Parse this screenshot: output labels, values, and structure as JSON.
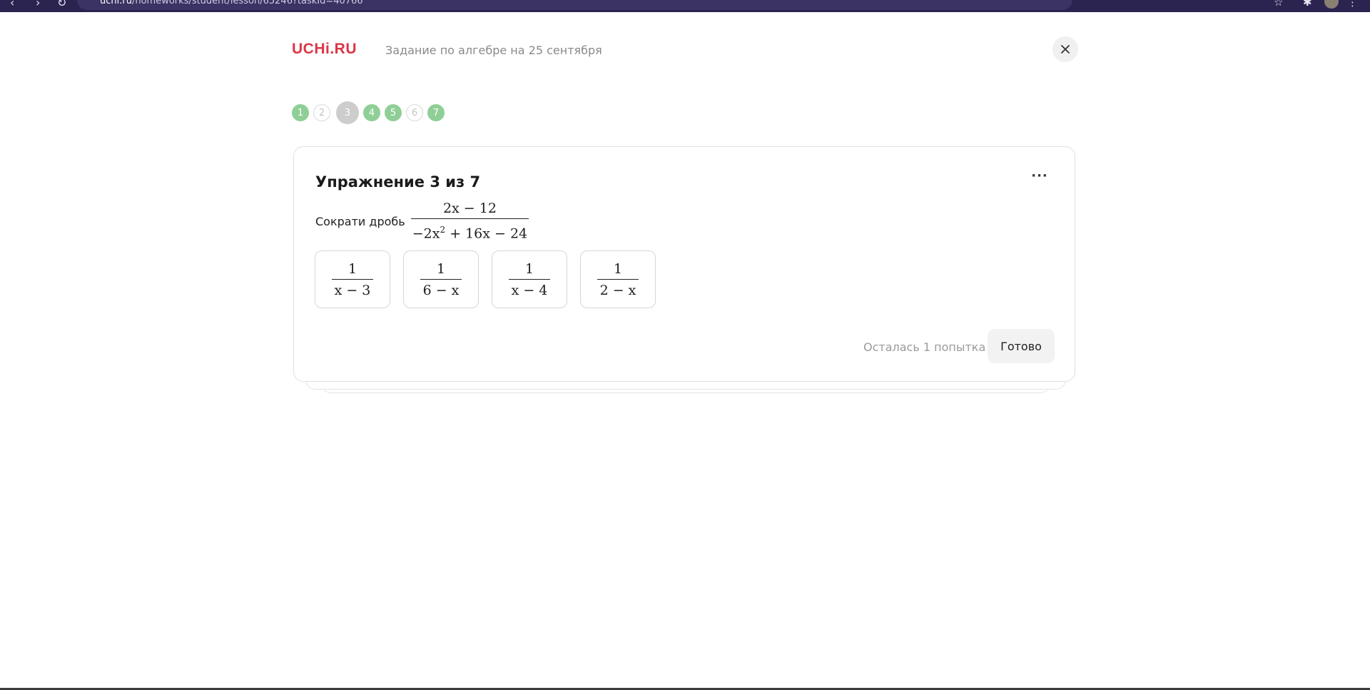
{
  "browser": {
    "url_host": "uchi.ru",
    "url_path": "/homeworks/student/lesson/65246?taskId=40766"
  },
  "header": {
    "logo": "UCHi.RU",
    "subtitle": "Задание по алгебре на 25 сентября",
    "close_icon": "close-icon"
  },
  "steps": [
    {
      "label": "1",
      "state": "done"
    },
    {
      "label": "2",
      "state": "todo"
    },
    {
      "label": "3",
      "state": "current"
    },
    {
      "label": "4",
      "state": "done"
    },
    {
      "label": "5",
      "state": "done"
    },
    {
      "label": "6",
      "state": "todo"
    },
    {
      "label": "7",
      "state": "done"
    }
  ],
  "exercise": {
    "title": "Упражнение 3 из 7",
    "more_label": "···",
    "prompt": "Сократи дробь",
    "fraction": {
      "numerator": "2x − 12",
      "denominator_a": "−2x",
      "denominator_exp": "2",
      "denominator_b": " + 16x − 24"
    },
    "options": [
      {
        "numerator": "1",
        "denominator": "x − 3"
      },
      {
        "numerator": "1",
        "denominator": "6 − x"
      },
      {
        "numerator": "1",
        "denominator": "x − 4"
      },
      {
        "numerator": "1",
        "denominator": "2 − x"
      }
    ],
    "attempts_text": "Осталась 1 попытка",
    "done_label": "Готово"
  },
  "colors": {
    "brand": "#dc3547",
    "step_done": "#8fcf97",
    "step_current": "#cdcdcd"
  }
}
